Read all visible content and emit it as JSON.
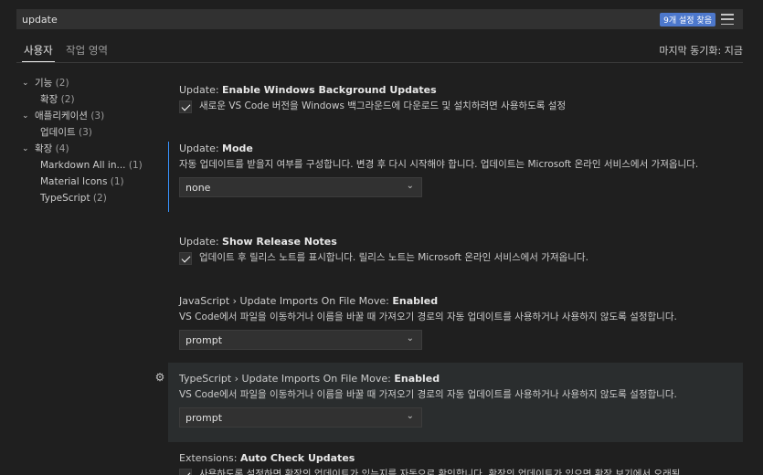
{
  "search": {
    "value": "update",
    "results_badge": "9개 설정 찾음",
    "filter_icon": "filter-list-icon"
  },
  "tabs": [
    {
      "label": "사용자",
      "active": true
    },
    {
      "label": "작업 영역",
      "active": false
    }
  ],
  "sync_status": "마지막 동기화: 지금",
  "tree": [
    {
      "label": "기능",
      "count": "(2)",
      "expanded": true
    },
    {
      "label": "확장",
      "count": "(2)"
    },
    {
      "label": "애플리케이션",
      "count": "(3)",
      "expanded": true
    },
    {
      "label": "업데이트",
      "count": "(3)"
    },
    {
      "label": "확장",
      "count": "(4)",
      "expanded": true
    },
    {
      "label": "Markdown All in...",
      "count": "(1)"
    },
    {
      "label": "Material Icons",
      "count": "(1)"
    },
    {
      "label": "TypeScript",
      "count": "(2)"
    }
  ],
  "settings": [
    {
      "category": "Update: ",
      "name": "Enable Windows Background Updates",
      "desc": "새로운 VS Code 버전을 Windows 백그라운드에 다운로드 및 설치하려면 사용하도록 설정",
      "checked": true
    },
    {
      "category": "Update: ",
      "name": "Mode",
      "desc": "자동 업데이트를 받을지 여부를 구성합니다. 변경 후 다시 시작해야 합니다. 업데이트는 Microsoft 온라인 서비스에서 가져옵니다.",
      "value": "none"
    },
    {
      "category": "Update: ",
      "name": "Show Release Notes",
      "desc": "업데이트 후 릴리스 노트를 표시합니다. 릴리스 노트는 Microsoft 온라인 서비스에서 가져옵니다.",
      "checked": true
    },
    {
      "category": "JavaScript › Update Imports On File Move: ",
      "name": "Enabled",
      "desc": "VS Code에서 파일을 이동하거나 이름을 바꿀 때 가져오기 경로의 자동 업데이트를 사용하거나 사용하지 않도록 설정합니다.",
      "value": "prompt"
    },
    {
      "category": "TypeScript › Update Imports On File Move: ",
      "name": "Enabled",
      "desc": "VS Code에서 파일을 이동하거나 이름을 바꿀 때 가져오기 경로의 자동 업데이트를 사용하거나 사용하지 않도록 설정합니다.",
      "value": "prompt"
    },
    {
      "category": "Extensions: ",
      "name": "Auto Check Updates",
      "desc": "사용하도록 설정하면 확장의 업데이트가 있는지를 자동으로 확인합니다. 확장의 업데이트가 있으면 확장 보기에서 오래됨",
      "checked": true
    }
  ],
  "colors": {
    "accent": "#3794ff",
    "badge": "#4d78cc",
    "background": "#1f1f1f"
  }
}
